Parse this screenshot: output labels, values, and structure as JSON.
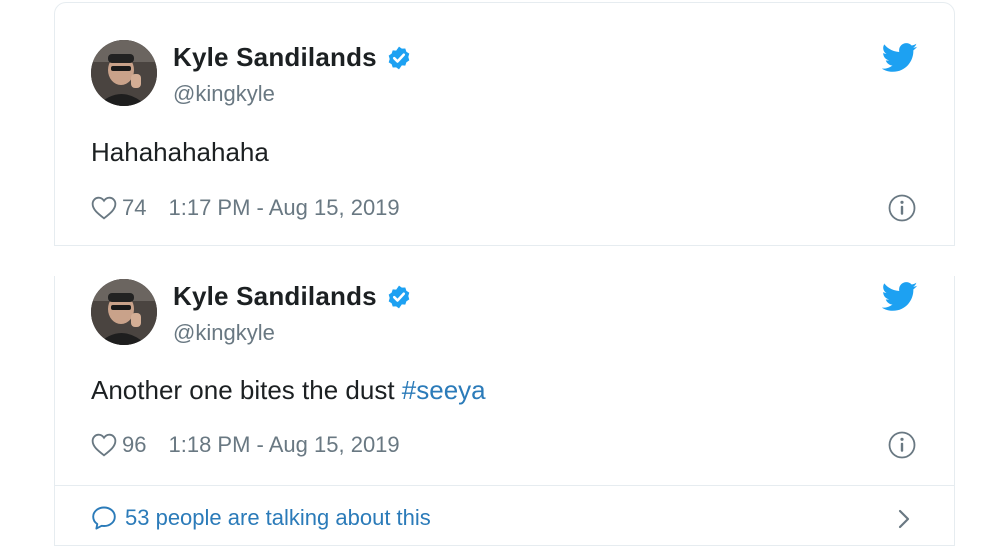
{
  "tweets": [
    {
      "author_name": "Kyle Sandilands",
      "author_handle": "@kingkyle",
      "text": "Hahahahahaha",
      "hashtag": "",
      "likes": "74",
      "timestamp": "1:17 PM - Aug 15, 2019"
    },
    {
      "author_name": "Kyle Sandilands",
      "author_handle": "@kingkyle",
      "text": "Another one bites the dust ",
      "hashtag": "#seeya",
      "likes": "96",
      "timestamp": "1:18 PM - Aug 15, 2019"
    }
  ],
  "conversation": {
    "label": "53 people are talking about this"
  },
  "icons": {
    "verified": "verified-badge-icon",
    "brand": "twitter-bird-icon",
    "like": "heart-icon",
    "info": "info-icon",
    "reply": "speech-bubble-icon",
    "expand": "chevron-right-icon"
  },
  "colors": {
    "link": "#2b7bb9",
    "twitter_blue": "#1da1f2",
    "muted": "#697882",
    "text": "#1c2022",
    "border": "#e6ecf0"
  }
}
